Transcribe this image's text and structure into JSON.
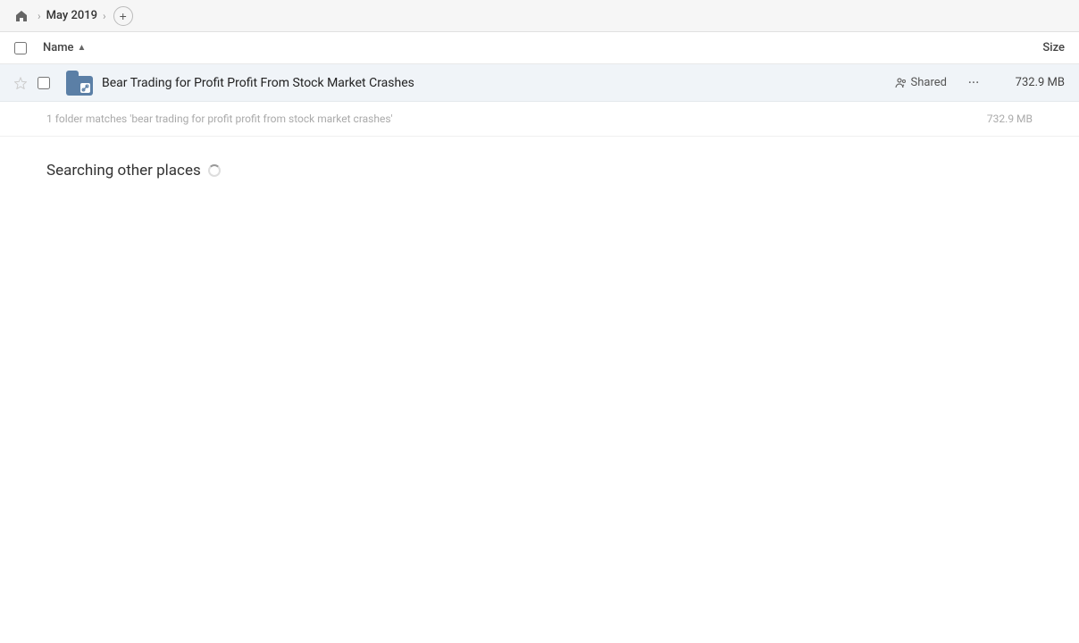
{
  "breadcrumb": {
    "home_icon": "🏠",
    "chevron1": "›",
    "title": "May 2019",
    "chevron2": "›",
    "add_button_label": "+"
  },
  "columns": {
    "name_label": "Name",
    "sort_arrow": "▲",
    "size_label": "Size"
  },
  "file_row": {
    "filename": "Bear Trading for Profit Profit From Stock Market Crashes",
    "shared_label": "Shared",
    "more_label": "···",
    "size": "732.9 MB"
  },
  "match_summary": {
    "text": "1 folder matches 'bear trading for profit profit from stock market crashes'",
    "size": "732.9 MB"
  },
  "searching_section": {
    "title": "Searching other places"
  }
}
